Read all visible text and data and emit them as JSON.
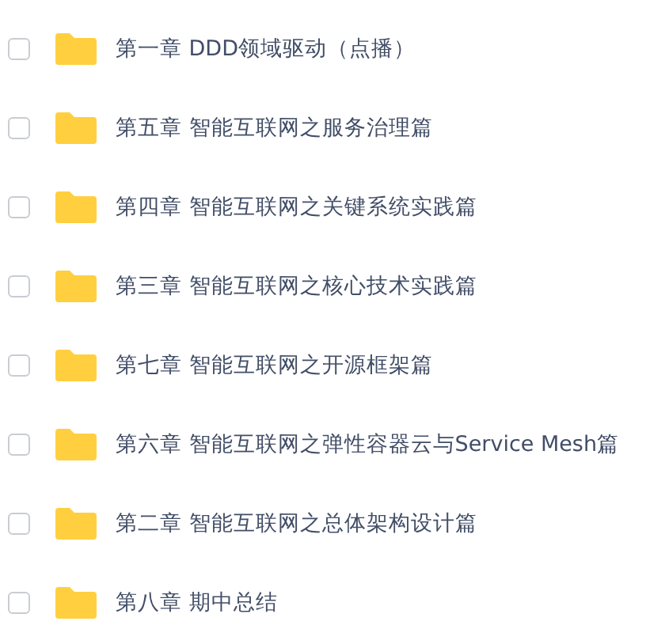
{
  "items": [
    {
      "name": "第一章 DDD领域驱动（点播）",
      "checked": false
    },
    {
      "name": "第五章 智能互联网之服务治理篇",
      "checked": false
    },
    {
      "name": "第四章 智能互联网之关键系统实践篇",
      "checked": false
    },
    {
      "name": "第三章 智能互联网之核心技术实践篇",
      "checked": false
    },
    {
      "name": "第七章 智能互联网之开源框架篇",
      "checked": false
    },
    {
      "name": "第六章 智能互联网之弹性容器云与Service Mesh篇",
      "checked": false
    },
    {
      "name": "第二章 智能互联网之总体架构设计篇",
      "checked": false
    },
    {
      "name": "第八章 期中总结",
      "checked": false
    }
  ]
}
